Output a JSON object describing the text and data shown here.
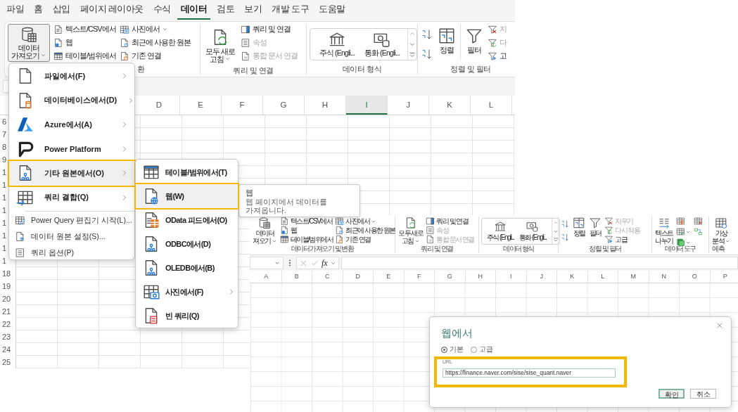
{
  "excel_window": {
    "tabs": [
      {
        "label": "파일",
        "selected": false
      },
      {
        "label": "홈",
        "selected": false
      },
      {
        "label": "삽입",
        "selected": false
      },
      {
        "label": "페이지 레이아웃",
        "selected": false
      },
      {
        "label": "수식",
        "selected": false
      },
      {
        "label": "데이터",
        "selected": true
      },
      {
        "label": "검토",
        "selected": false
      },
      {
        "label": "보기",
        "selected": false
      },
      {
        "label": "개발 도구",
        "selected": false
      },
      {
        "label": "도움말",
        "selected": false
      }
    ],
    "ribbon": {
      "get_data": {
        "lines": [
          "데이터",
          "가져오기"
        ]
      },
      "get_items": [
        {
          "label": "텍스트/CSV에서",
          "kind": "doctext",
          "dropdown": false
        },
        {
          "label": "웹",
          "kind": "docinfo",
          "dropdown": false
        },
        {
          "label": "테이블/범위에서",
          "kind": "tablehead",
          "dropdown": false
        }
      ],
      "get_items_2": [
        {
          "label": "사진에서",
          "kind": "tablecamera",
          "dropdown": true
        },
        {
          "label": "최근에 사용한 원본",
          "kind": "docclock",
          "dropdown": false
        },
        {
          "label": "기존 연결",
          "kind": "doclock",
          "dropdown": false
        }
      ],
      "get_group_label": "환",
      "refresh": {
        "lines": [
          "모두 새로",
          "고침"
        ]
      },
      "query_items": [
        {
          "label": "쿼리 및 연결",
          "kind": "panel",
          "disabled": false
        },
        {
          "label": "속성",
          "kind": "list",
          "disabled": true
        },
        {
          "label": "통합 문서 연결",
          "kind": "doclink",
          "disabled": true
        }
      ],
      "query_group_label": "쿼리 및 연결",
      "data_types": [
        {
          "label": "주식 (Engli...",
          "kind": "bank"
        },
        {
          "label": "통화 (Engli...",
          "kind": "money"
        }
      ],
      "data_types_label": "데이터 형식",
      "sort_label": "정렬",
      "filter_label": "필터",
      "filter_items": [
        {
          "label": "지",
          "kind": "funnelx",
          "disabled": true
        },
        {
          "label": "다",
          "kind": "funnelrefresh",
          "disabled": true
        },
        {
          "label": "고",
          "kind": "funnelgear",
          "disabled": false
        }
      ],
      "sort_group_label": "정렬 및 필터"
    },
    "columns": [
      {
        "label": "D",
        "selected": false
      },
      {
        "label": "E",
        "selected": false
      },
      {
        "label": "F",
        "selected": false
      },
      {
        "label": "G",
        "selected": false
      },
      {
        "label": "H",
        "selected": false
      },
      {
        "label": "I",
        "selected": true
      },
      {
        "label": "J",
        "selected": false
      },
      {
        "label": "K",
        "selected": false
      },
      {
        "label": "L",
        "selected": false
      }
    ],
    "row_headers": [
      "6",
      "7",
      "8",
      "9",
      "1",
      "1",
      "1",
      "1",
      "1",
      "1",
      "1",
      "1",
      "18",
      "19",
      "20",
      "21",
      "22",
      "23",
      "24",
      "25"
    ]
  },
  "get_data_menu": {
    "items": [
      {
        "label": "파일에서(F)",
        "kind": "doc",
        "submenu": true,
        "selected": false,
        "highlighted": false
      },
      {
        "label": "데이터베이스에서(D)",
        "kind": "docdb",
        "submenu": true,
        "selected": false,
        "highlighted": false
      },
      {
        "label": "Azure에서(A)",
        "kind": "azure",
        "submenu": true,
        "selected": false,
        "highlighted": false
      },
      {
        "label": "Power Platform",
        "kind": "platform",
        "submenu": true,
        "selected": false,
        "highlighted": false
      },
      {
        "label": "기타 원본에서(O)",
        "kind": "docnet",
        "submenu": true,
        "selected": true,
        "highlighted": true
      },
      {
        "label": "쿼리 결합(Q)",
        "kind": "tablearrow",
        "submenu": true,
        "selected": false,
        "highlighted": false
      }
    ],
    "commands": [
      {
        "label": "Power Query 편집기 시작(L)...",
        "kind": "tablepencil"
      },
      {
        "label": "데이터 원본 설정(S)...",
        "kind": "docgear"
      },
      {
        "label": "쿼리 옵션(P)",
        "kind": "list"
      }
    ]
  },
  "other_sources_menu": {
    "items": [
      {
        "label": "테이블/범위에서(T)",
        "kind": "tablehead",
        "submenu": false,
        "selected": false,
        "highlighted": false
      },
      {
        "label": "웹(W)",
        "kind": "docglobe",
        "submenu": false,
        "selected": true,
        "highlighted": true
      },
      {
        "label": "OData 피드에서(O)",
        "kind": "docgrid",
        "submenu": false,
        "selected": false,
        "highlighted": false
      },
      {
        "label": "ODBC에서(D)",
        "kind": "docnet",
        "submenu": false,
        "selected": false,
        "highlighted": false
      },
      {
        "label": "OLEDB에서(B)",
        "kind": "docnet",
        "submenu": false,
        "selected": false,
        "highlighted": false
      },
      {
        "label": "사진에서(F)",
        "kind": "tablecamera",
        "submenu": true,
        "selected": false,
        "highlighted": false
      },
      {
        "label": "빈 쿼리(Q)",
        "kind": "docscroll",
        "submenu": false,
        "selected": false,
        "highlighted": false
      }
    ]
  },
  "tooltip": {
    "title": "웹",
    "description": "웹 페이지에서 데이터를 가져옵니다."
  },
  "second_window": {
    "ribbon": {
      "get_data": {
        "lines": [
          "데이터",
          "져오기"
        ]
      },
      "get_items": [
        {
          "label": "텍스트/CSV에서",
          "kind": "doctext",
          "dropdown": false
        },
        {
          "label": "웹",
          "kind": "docinfo",
          "dropdown": false
        },
        {
          "label": "테이블/범위에서",
          "kind": "tablehead",
          "dropdown": false
        }
      ],
      "get_items_2": [
        {
          "label": "사진에서",
          "kind": "tablecamera",
          "dropdown": true
        },
        {
          "label": "최근에 사용한 원본",
          "kind": "docclock",
          "dropdown": false
        },
        {
          "label": "기존 연결",
          "kind": "doclock",
          "dropdown": false
        }
      ],
      "get_group_label": "데이터 가져오기 및 변환",
      "refresh": {
        "lines": [
          "모두 새로",
          "고침"
        ]
      },
      "query_items": [
        {
          "label": "쿼리 및 연결",
          "kind": "panel",
          "disabled": false
        },
        {
          "label": "속성",
          "kind": "list",
          "disabled": true
        },
        {
          "label": "통합 문서 연결",
          "kind": "doclink",
          "disabled": true
        }
      ],
      "query_group_label": "쿼리 및 연결",
      "data_types": [
        {
          "label": "주식 (Engli...",
          "kind": "bank"
        },
        {
          "label": "통화 (Engli...",
          "kind": "money"
        }
      ],
      "data_types_label": "데이터 형식",
      "sort_label": "정렬",
      "filter_label": "필터",
      "filter_items": [
        {
          "label": "지우기",
          "kind": "funnelx",
          "disabled": true
        },
        {
          "label": "다시 적용",
          "kind": "funnelrefresh",
          "disabled": true
        },
        {
          "label": "고급",
          "kind": "funnelgear",
          "disabled": false
        }
      ],
      "sort_group_label": "정렬 및 필터",
      "split": {
        "lines": [
          "텍스트",
          "나누기"
        ]
      },
      "tools": [
        {
          "kind": "tablebolt",
          "dropdown": false
        },
        {
          "kind": "tablex",
          "dropdown": false
        },
        {
          "kind": "tablecheck",
          "dropdown": true
        },
        {
          "kind": "boxes",
          "dropdown": false
        },
        {
          "kind": "sheet",
          "dropdown": true
        }
      ],
      "tools_label": "데이터 도구",
      "what_if": {
        "lines": [
          "가상",
          "분석"
        ]
      },
      "forecast_label": "예측"
    },
    "formula_label": "fx",
    "columns": [
      "A",
      "B",
      "C",
      "D",
      "E",
      "F",
      "G",
      "H",
      "I",
      "J",
      "K",
      "L",
      "M",
      "N",
      "O",
      "P"
    ]
  },
  "web_dialog": {
    "title": "웹에서",
    "modes": [
      {
        "label": "기본",
        "selected": true
      },
      {
        "label": "고급",
        "selected": false
      }
    ],
    "url_label": "URL",
    "url": "https://finance.naver.com/sise/sise_quant.naver",
    "url_highlighted": true,
    "buttons": [
      {
        "label": "확인",
        "primary": true
      },
      {
        "label": "취소",
        "primary": false
      }
    ]
  }
}
